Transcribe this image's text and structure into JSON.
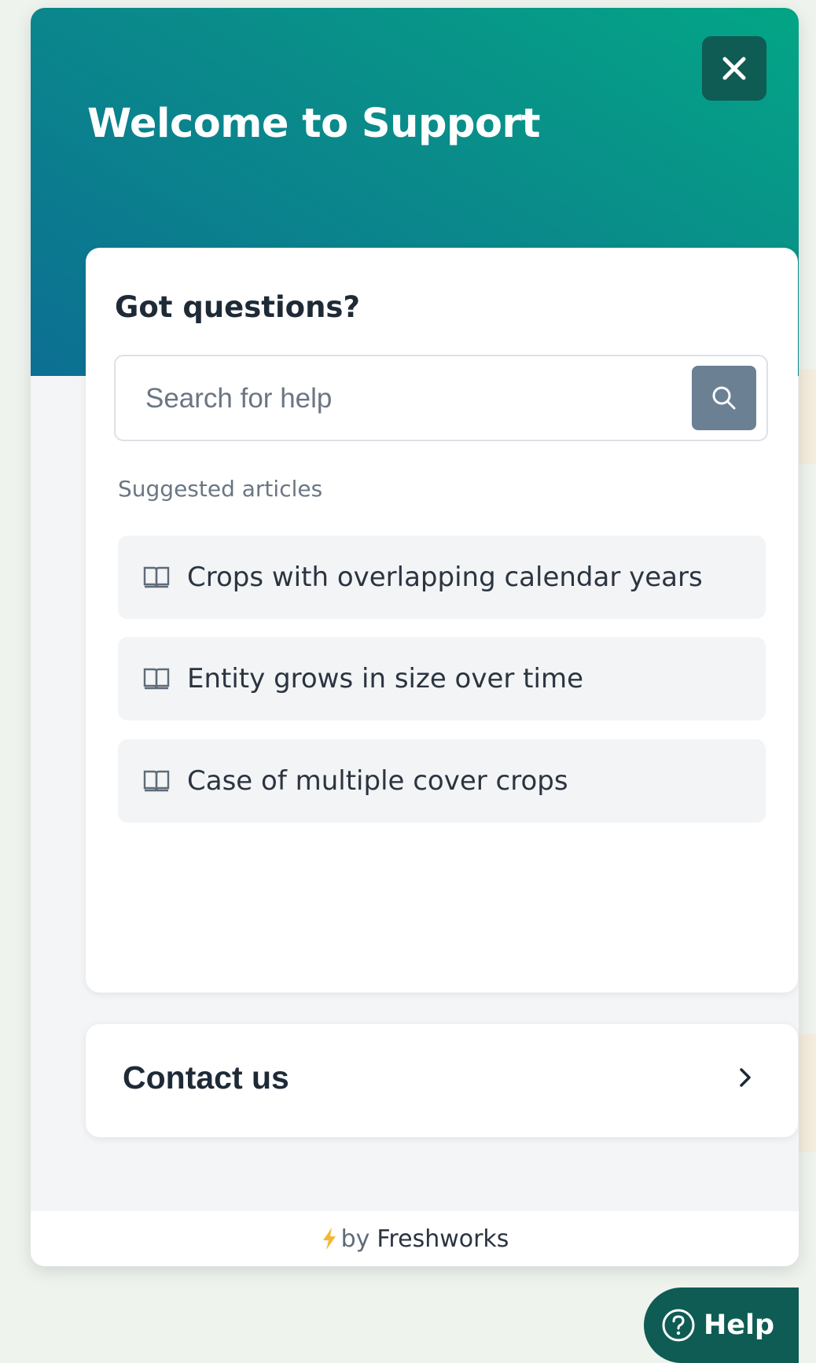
{
  "widget": {
    "hero_title": "Welcome to Support",
    "close_icon": "close-icon",
    "colors": {
      "hero_start": "#03a586",
      "hero_end": "#0c6f93",
      "close_bg": "#0e5c54",
      "search_button_bg": "#6c8094"
    }
  },
  "questions": {
    "title": "Got questions?",
    "search": {
      "placeholder": "Search for help",
      "value": "",
      "icon": "search-icon"
    },
    "suggested_label": "Suggested articles",
    "articles": [
      {
        "label": "Crops with overlapping calendar years",
        "icon": "book-icon"
      },
      {
        "label": "Entity grows in size over time",
        "icon": "book-icon"
      },
      {
        "label": "Case of multiple cover crops",
        "icon": "book-icon"
      }
    ]
  },
  "contact": {
    "label": "Contact us",
    "icon": "chevron-right-icon"
  },
  "footer": {
    "by": "by",
    "brand": "Freshworks",
    "icon": "bolt-icon"
  },
  "launcher": {
    "label": "Help",
    "icon": "help-circle-icon"
  }
}
